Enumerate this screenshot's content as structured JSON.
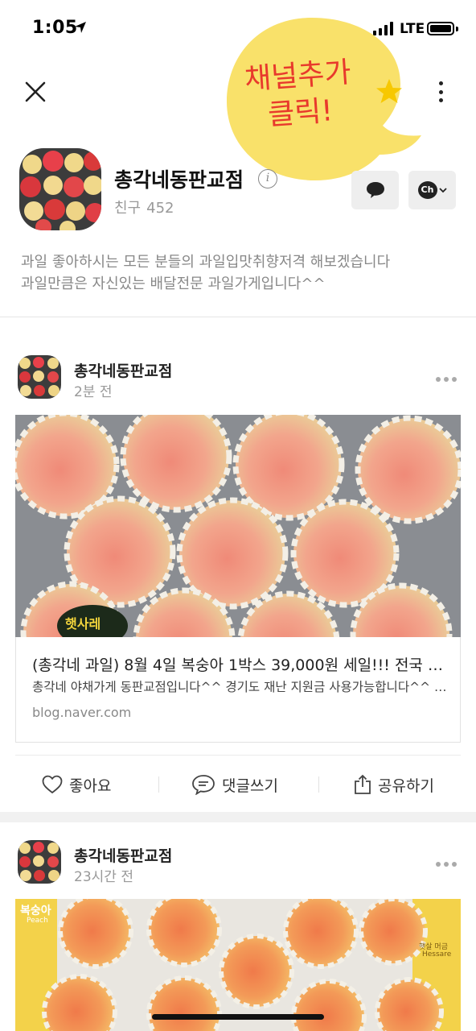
{
  "status_bar": {
    "time": "1:05",
    "network": "LTE"
  },
  "annotation": {
    "line1": "채널추가",
    "line2": "클릭!",
    "star": "★"
  },
  "profile": {
    "name": "총각네동판교점",
    "info_icon": "i",
    "friends_label": "친구",
    "friends_count": "452",
    "description_line1": "과일 좋아하시는 모든 분들의 과일입맛취향저격 해보겠습니다",
    "description_line2": "과일만큼은 자신있는 배달전문 과일가게입니다^^",
    "channel_badge": "Ch"
  },
  "posts": [
    {
      "author": "총각네동판교점",
      "time": "2분 전",
      "image_label": "햇사레",
      "link_title": "(총각네 과일) 8월 4일 복숭아 1박스 39,000원 세일!!! 전국 최저가",
      "link_desc": "총각네 야채가게 동판교점입니다^^ 경기도 재난 지원금 사용가능합니다^^ 매장 방문",
      "link_domain": "blog.naver.com"
    },
    {
      "author": "총각네동판교점",
      "time": "23시간 전",
      "image_label_left": "복숭아",
      "image_label_peach": "Peach",
      "image_label_right": "햇살 머금",
      "image_label_hessare": "Hessare"
    }
  ],
  "actions": {
    "like": "좋아요",
    "comment": "댓글쓰기",
    "share": "공유하기"
  },
  "colors": {
    "bubble": "#f9e16a",
    "bubble_text": "#e8392c",
    "star": "#f7c800"
  }
}
